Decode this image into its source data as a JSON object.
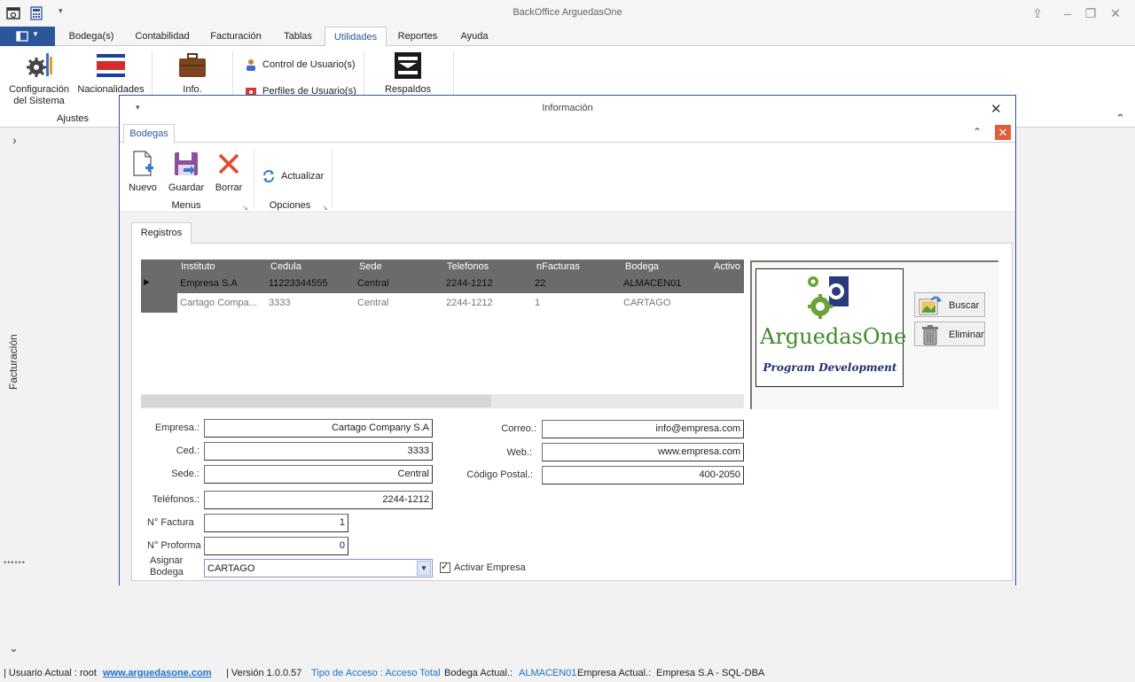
{
  "app": {
    "title": "BackOffice ArguedasOne",
    "tabs": [
      "Bodega(s)",
      "Contabilidad",
      "Facturación",
      "Tablas",
      "Utilidades",
      "Reportes",
      "Ayuda"
    ],
    "active_tab": "Utilidades"
  },
  "ribbon": {
    "config_label": "Configuración del Sistema",
    "nacionalidades_label": "Nacionalidades",
    "ajustes_group": "Ajustes",
    "info_label": "Info.",
    "control_usuario": "Control de Usuario(s)",
    "perfiles_usuario": "Perfiles de Usuario(s)",
    "respaldos_label": "Respaldos"
  },
  "left_panel": {
    "label": "Facturación"
  },
  "dialog": {
    "title": "Información",
    "tab": "Bodegas",
    "buttons": {
      "nuevo": "Nuevo",
      "guardar": "Guardar",
      "borrar": "Borrar",
      "actualizar": "Actualizar"
    },
    "groups": {
      "menus": "Menus",
      "opciones": "Opciones"
    },
    "registros_tab": "Registros"
  },
  "grid": {
    "columns": [
      "Instituto",
      "Cedula",
      "Sede",
      "Telefonos",
      "nFacturas",
      "Bodega",
      "Activo"
    ],
    "rows": [
      {
        "instituto": "Empresa S.A",
        "cedula": "11223344555",
        "sede": "Central",
        "telefonos": "2244-1212",
        "nfacturas": "22",
        "bodega": "ALMACEN01"
      },
      {
        "instituto": "Cartago Compa...",
        "cedula": "3333",
        "sede": "Central",
        "telefonos": "2244-1212",
        "nfacturas": "1",
        "bodega": "CARTAGO"
      }
    ]
  },
  "logo": {
    "brand": "ArguedasOne",
    "tagline": "Program Development",
    "buscar": "Buscar",
    "eliminar": "Eliminar"
  },
  "form": {
    "empresa_label": "Empresa.:",
    "empresa": "Cartago Company S.A",
    "ced_label": "Ced.:",
    "ced": "3333",
    "sede_label": "Sede.:",
    "sede": "Central",
    "telefonos_label": "Teléfonos.:",
    "telefonos": "2244-1212",
    "nfactura_label": "N° Factura",
    "nfactura": "1",
    "nproforma_label": "N° Proforma",
    "nproforma": "0",
    "asignar_label_1": "Asignar",
    "asignar_label_2": "Bodega",
    "bodega": "CARTAGO",
    "activar_label": "Activar Empresa",
    "correo_label": "Correo.:",
    "correo": "info@empresa.com",
    "web_label": "Web.:",
    "web": "www.empresa.com",
    "postal_label": "Código Postal.:",
    "postal": "400-2050"
  },
  "status": {
    "usuario": "| Usuario Actual : root",
    "link": "www.arguedasone.com",
    "version": "| Versión 1.0.0.57",
    "acceso": "Tipo de Acceso : Acceso Total",
    "bodega_label": "Bodega Actual.:",
    "bodega": "ALMACEN01",
    "empresa_label": "Empresa Actual.:",
    "empresa": "Empresa S.A  - SQL-DBA"
  },
  "colors": {
    "accent": "#2b579a",
    "close_red": "#e35d3b",
    "grid_header": "#6b6b6b",
    "selected_row": "#6b6b6b"
  }
}
